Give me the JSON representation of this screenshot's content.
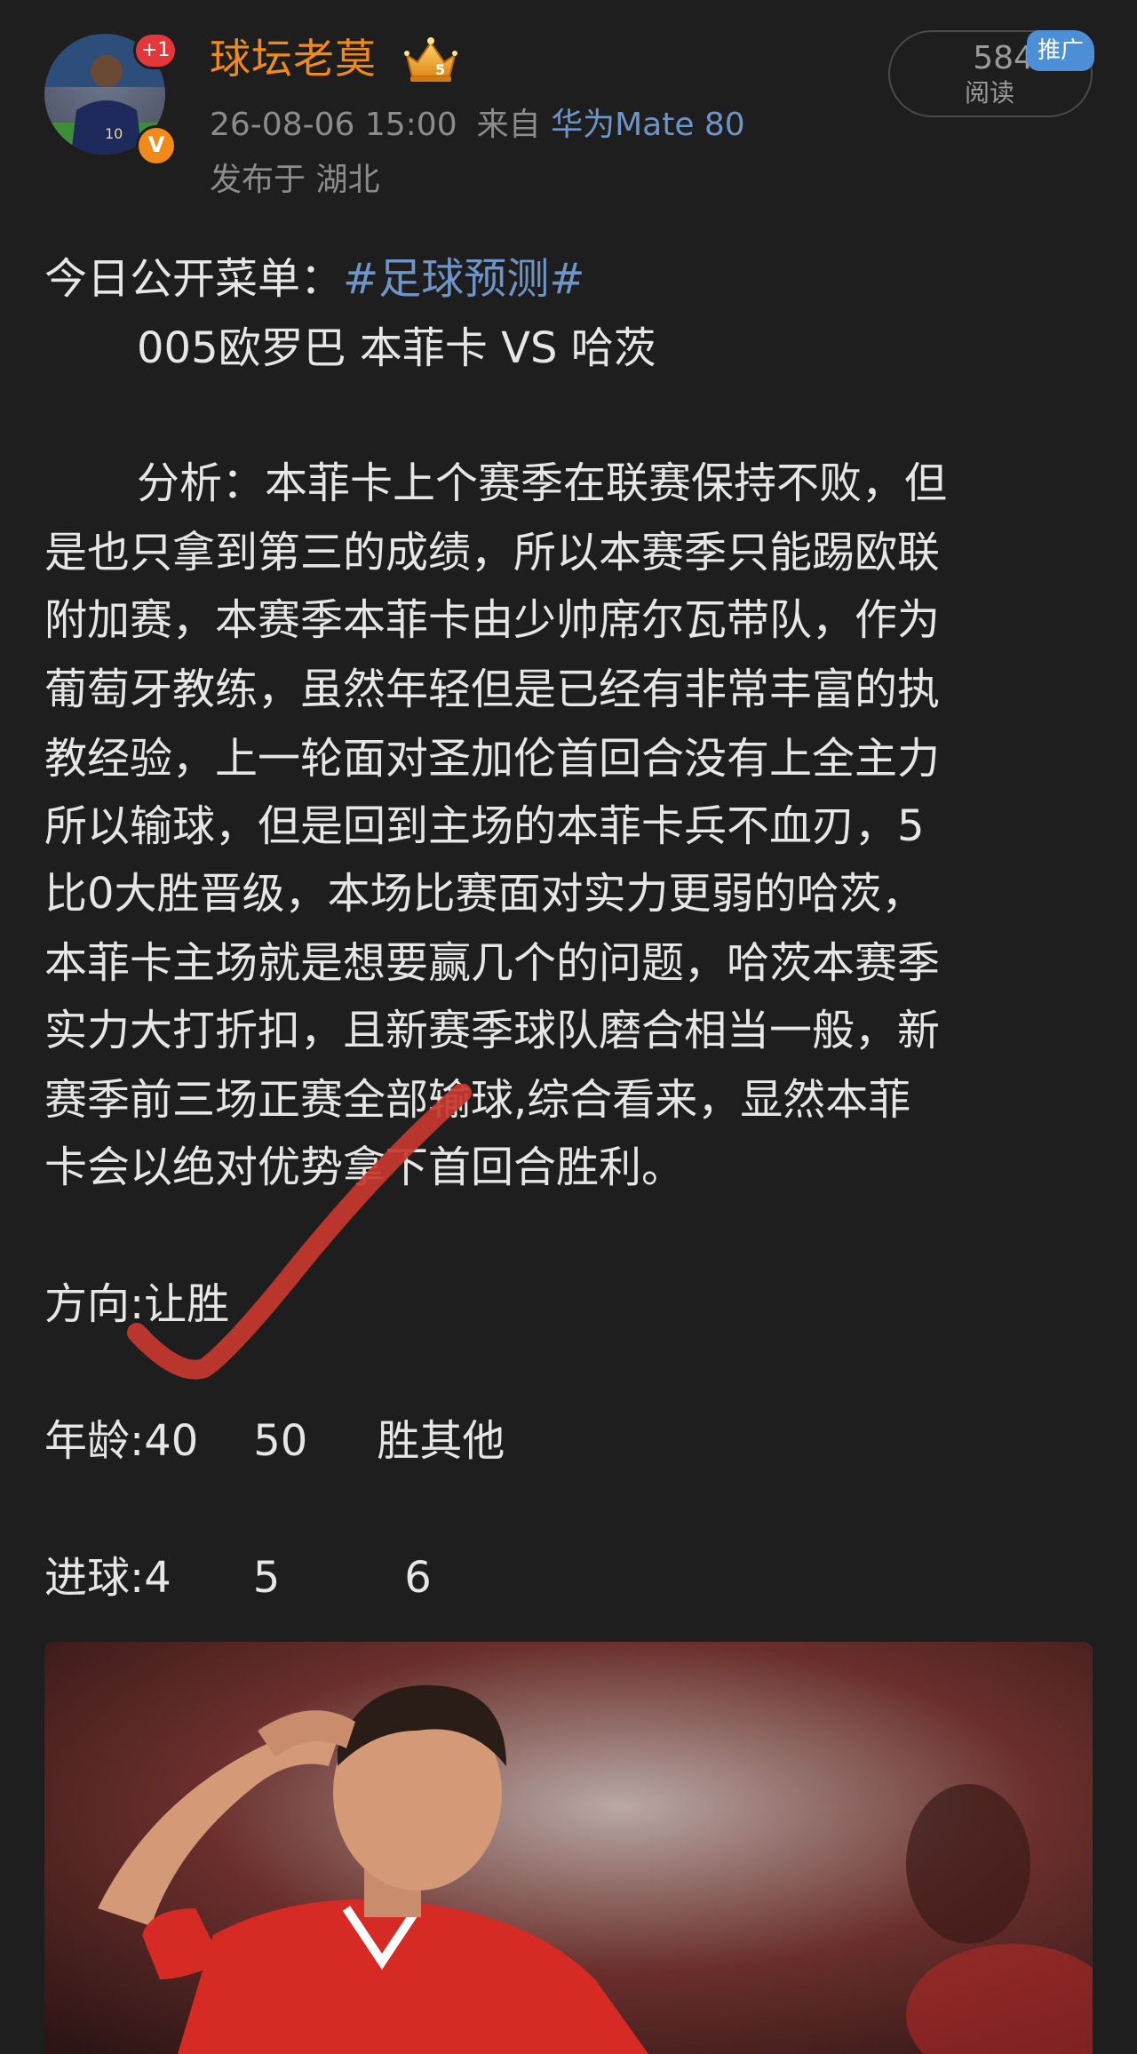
{
  "header": {
    "username": "球坛老莫",
    "notification_badge": "+1",
    "verified_badge": "V",
    "level_badge": "5",
    "date": "26-08-06 15:00",
    "source_prefix": "来自",
    "device": "华为Mate 80",
    "location": "发布于 湖北",
    "read_count": "584",
    "read_label": "阅读",
    "promo_label": "推广"
  },
  "post": {
    "intro_prefix": "今日公开菜单：",
    "hashtag": "#足球预测#",
    "match": "005欧罗巴 本菲卡 VS 哈茨",
    "analysis_lines": [
      "分析：本菲卡上个赛季在联赛保持不败，但",
      "是也只拿到第三的成绩，所以本赛季只能踢欧联",
      "附加赛，本赛季本菲卡由少帅席尔瓦带队，作为",
      "葡萄牙教练，虽然年轻但是已经有非常丰富的执",
      "教经验，上一轮面对圣加伦首回合没有上全主力",
      "所以输球，但是回到主场的本菲卡兵不血刃，5",
      "比0大胜晋级，本场比赛面对实力更弱的哈茨，",
      "本菲卡主场就是想要赢几个的问题，哈茨本赛季",
      "实力大打折扣，且新赛季球队磨合相当一般，新",
      "赛季前三场正赛全部输球,综合看来，显然本菲",
      "卡会以绝对优势拿下首回合胜利。"
    ],
    "direction": "方向:让胜",
    "age": {
      "label": "年龄:",
      "values": [
        "40",
        "50",
        "胜其他"
      ]
    },
    "goals": {
      "label": "进球:",
      "values": [
        "4",
        "5",
        "6"
      ]
    }
  },
  "colors": {
    "background": "#1e1e1e",
    "username": "#f08a1b",
    "link": "#6f95c8",
    "check_mark": "#c8372d",
    "promo": "#4c8fd6"
  },
  "icons": [
    "crown-icon",
    "verified-icon",
    "check-mark-icon"
  ]
}
